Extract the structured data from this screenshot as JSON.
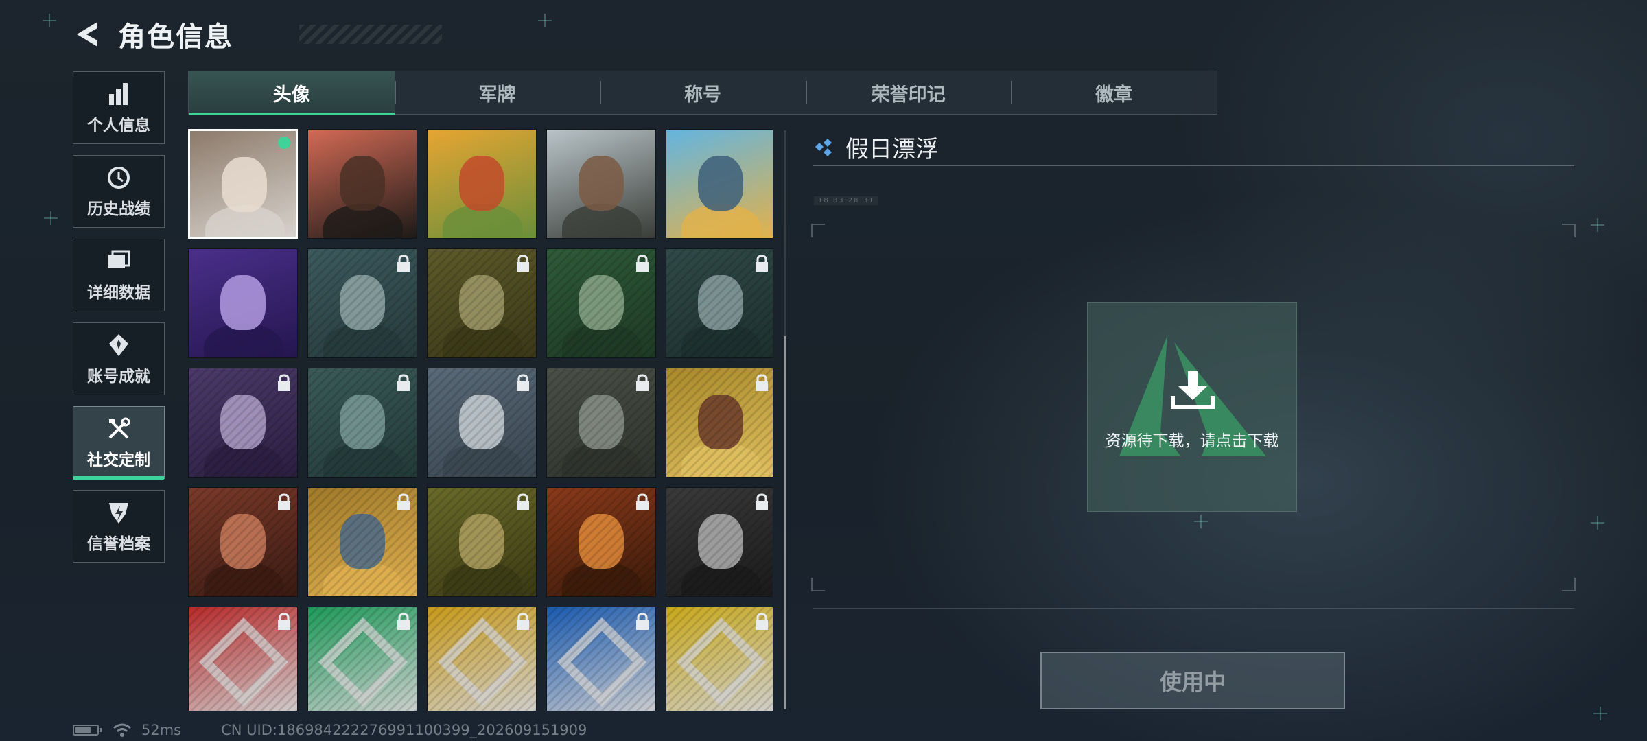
{
  "header": {
    "title": "角色信息"
  },
  "sidebar": {
    "items": [
      {
        "label": "个人信息",
        "icon": "bar-chart-icon"
      },
      {
        "label": "历史战绩",
        "icon": "history-clock-icon"
      },
      {
        "label": "详细数据",
        "icon": "folder-data-icon"
      },
      {
        "label": "账号成就",
        "icon": "achievement-badge-icon"
      },
      {
        "label": "社交定制",
        "icon": "tools-icon",
        "active": true
      },
      {
        "label": "信誉档案",
        "icon": "credit-shield-icon"
      }
    ]
  },
  "tabs": [
    {
      "label": "头像",
      "active": true
    },
    {
      "label": "军牌"
    },
    {
      "label": "称号"
    },
    {
      "label": "荣誉印记"
    },
    {
      "label": "徽章"
    }
  ],
  "avatars": [
    {
      "name": "photo-cat-avatar",
      "locked": false,
      "selected": true,
      "in_use": true
    },
    {
      "name": "headset-soldier-red-avatar",
      "locked": false
    },
    {
      "name": "festive-emblem-avatar",
      "locked": false
    },
    {
      "name": "anime-soldier-dog-avatar",
      "locked": false
    },
    {
      "name": "fish-mascot-avatar",
      "locked": false
    },
    {
      "name": "purple-glasses-man-avatar",
      "locked": false
    },
    {
      "name": "pilot-woman-avatar",
      "locked": true
    },
    {
      "name": "bald-soldier-avatar",
      "locked": true
    },
    {
      "name": "headset-operator-avatar",
      "locked": true
    },
    {
      "name": "bearded-operator-avatar",
      "locked": true
    },
    {
      "name": "purple-woman-avatar",
      "locked": true
    },
    {
      "name": "masked-helmet-avatar",
      "locked": true
    },
    {
      "name": "star-gear-emblem-avatar",
      "locked": true
    },
    {
      "name": "helicopter-field-avatar",
      "locked": true
    },
    {
      "name": "gift-mascot-avatar",
      "locked": true
    },
    {
      "name": "red-hair-woman-avatar",
      "locked": true
    },
    {
      "name": "eri-globe-emblem-avatar",
      "locked": true
    },
    {
      "name": "glasses-man-avatar",
      "locked": true
    },
    {
      "name": "explosion-avatar",
      "locked": true
    },
    {
      "name": "pistol-soldier-avatar",
      "locked": true
    },
    {
      "name": "red-shield-emblem-avatar",
      "locked": true
    },
    {
      "name": "green-cross-emblem-avatar",
      "locked": true
    },
    {
      "name": "yellow-a-emblem-avatar",
      "locked": true
    },
    {
      "name": "blue-hex-emblem-avatar",
      "locked": true
    },
    {
      "name": "yellow-diamond-emblem-avatar",
      "locked": true
    }
  ],
  "detail": {
    "name": "假日漂浮",
    "meta": "18 83  28 31",
    "download_text": "资源待下载，请点击下载",
    "use_button": "使用中"
  },
  "status": {
    "ping": "52ms",
    "uid": "CN UID:1869842222769911003​99_202609151909"
  },
  "colors": {
    "accent": "#3fd39a",
    "background": "#1a232b"
  }
}
